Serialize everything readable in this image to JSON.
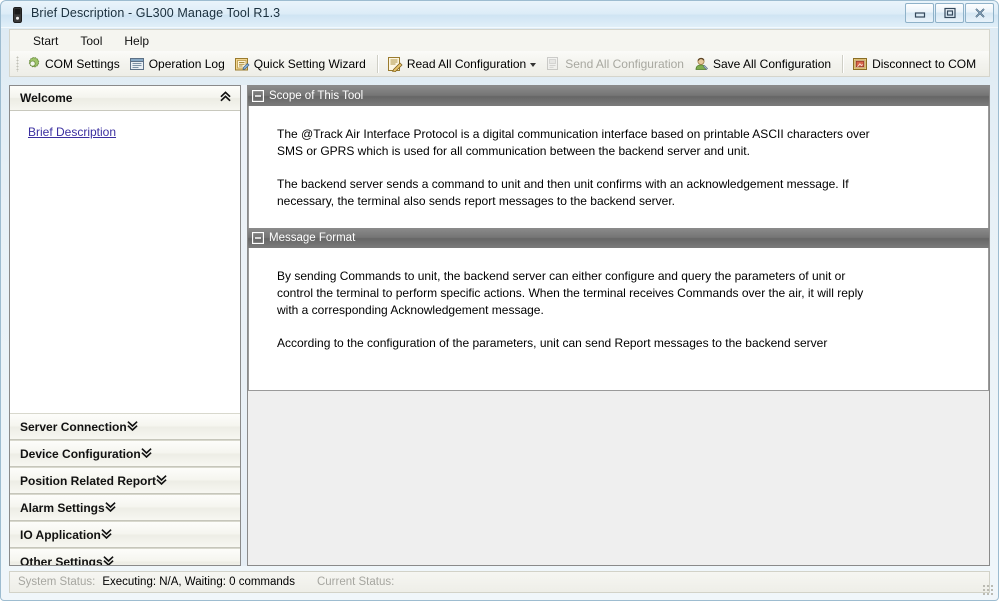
{
  "window": {
    "title": "Brief Description - GL300 Manage Tool R1.3",
    "app_icon": "device-icon",
    "buttons": [
      {
        "name": "minimize",
        "icon": "minimize-icon"
      },
      {
        "name": "restore",
        "icon": "restore-icon"
      },
      {
        "name": "close",
        "icon": "close-icon"
      }
    ]
  },
  "menubar": {
    "items": [
      {
        "label": "Start"
      },
      {
        "label": "Tool"
      },
      {
        "label": "Help"
      }
    ]
  },
  "toolbar": {
    "items": [
      {
        "label": "COM Settings",
        "icon": "gear-icon",
        "disabled": false,
        "dropdown": false
      },
      {
        "label": "Operation Log",
        "icon": "log-window-icon",
        "disabled": false,
        "dropdown": false
      },
      {
        "label": "Quick Setting Wizard",
        "icon": "wizard-icon",
        "disabled": false,
        "dropdown": false
      },
      {
        "label": "Read All Configuration",
        "icon": "read-config-icon",
        "disabled": false,
        "dropdown": true
      },
      {
        "label": "Send All Configuration",
        "icon": "send-config-icon",
        "disabled": true,
        "dropdown": false
      },
      {
        "label": "Save All Configuration",
        "icon": "save-config-icon",
        "disabled": false,
        "dropdown": false
      },
      {
        "label": "Disconnect to COM",
        "icon": "disconnect-icon",
        "disabled": false,
        "dropdown": false
      }
    ]
  },
  "sidebar": {
    "welcome": {
      "title": "Welcome",
      "chevron": "chevron-double-up-icon",
      "expanded": true,
      "links": [
        {
          "label": "Brief Description",
          "selected": true
        }
      ]
    },
    "sections": [
      {
        "label": "Server Connection",
        "chevron": "chevron-double-down-icon",
        "expanded": false
      },
      {
        "label": "Device Configuration",
        "chevron": "chevron-double-down-icon",
        "expanded": false
      },
      {
        "label": "Position Related Report",
        "chevron": "chevron-double-down-icon",
        "expanded": false
      },
      {
        "label": "Alarm Settings",
        "chevron": "chevron-double-down-icon",
        "expanded": false
      },
      {
        "label": "IO Application",
        "chevron": "chevron-double-down-icon",
        "expanded": false
      },
      {
        "label": "Other Settings",
        "chevron": "chevron-double-down-icon",
        "expanded": false
      }
    ]
  },
  "content": {
    "panels": [
      {
        "title": "Scope of This Tool",
        "collapse_icon": "collapse-minus-icon",
        "paragraphs": [
          "The @Track Air Interface Protocol is a digital communication interface based on printable ASCII characters over SMS or GPRS which is used for all communication between the backend server and unit.",
          "The backend server sends a command to unit and then unit confirms with an acknowledgement message. If necessary, the terminal also sends report messages to the backend server."
        ]
      },
      {
        "title": "Message Format",
        "collapse_icon": "collapse-minus-icon",
        "paragraphs": [
          "By sending Commands to unit, the backend server can either configure and query the parameters of unit or control the terminal to perform specific actions. When the terminal receives Commands over the air, it will reply with a corresponding Acknowledgement message.",
          "According to the configuration of the parameters, unit can send Report messages to the backend server"
        ]
      }
    ]
  },
  "statusbar": {
    "system_status_label": "System Status:",
    "system_status_value": "Executing: N/A, Waiting: 0 commands",
    "current_status_label": "Current Status:",
    "current_status_value": ""
  },
  "colors": {
    "title_accent": "#cfe4f3",
    "panel_header": "#6e6e6e",
    "link": "#3b2fa0",
    "status_label": "#a6a6a0"
  }
}
